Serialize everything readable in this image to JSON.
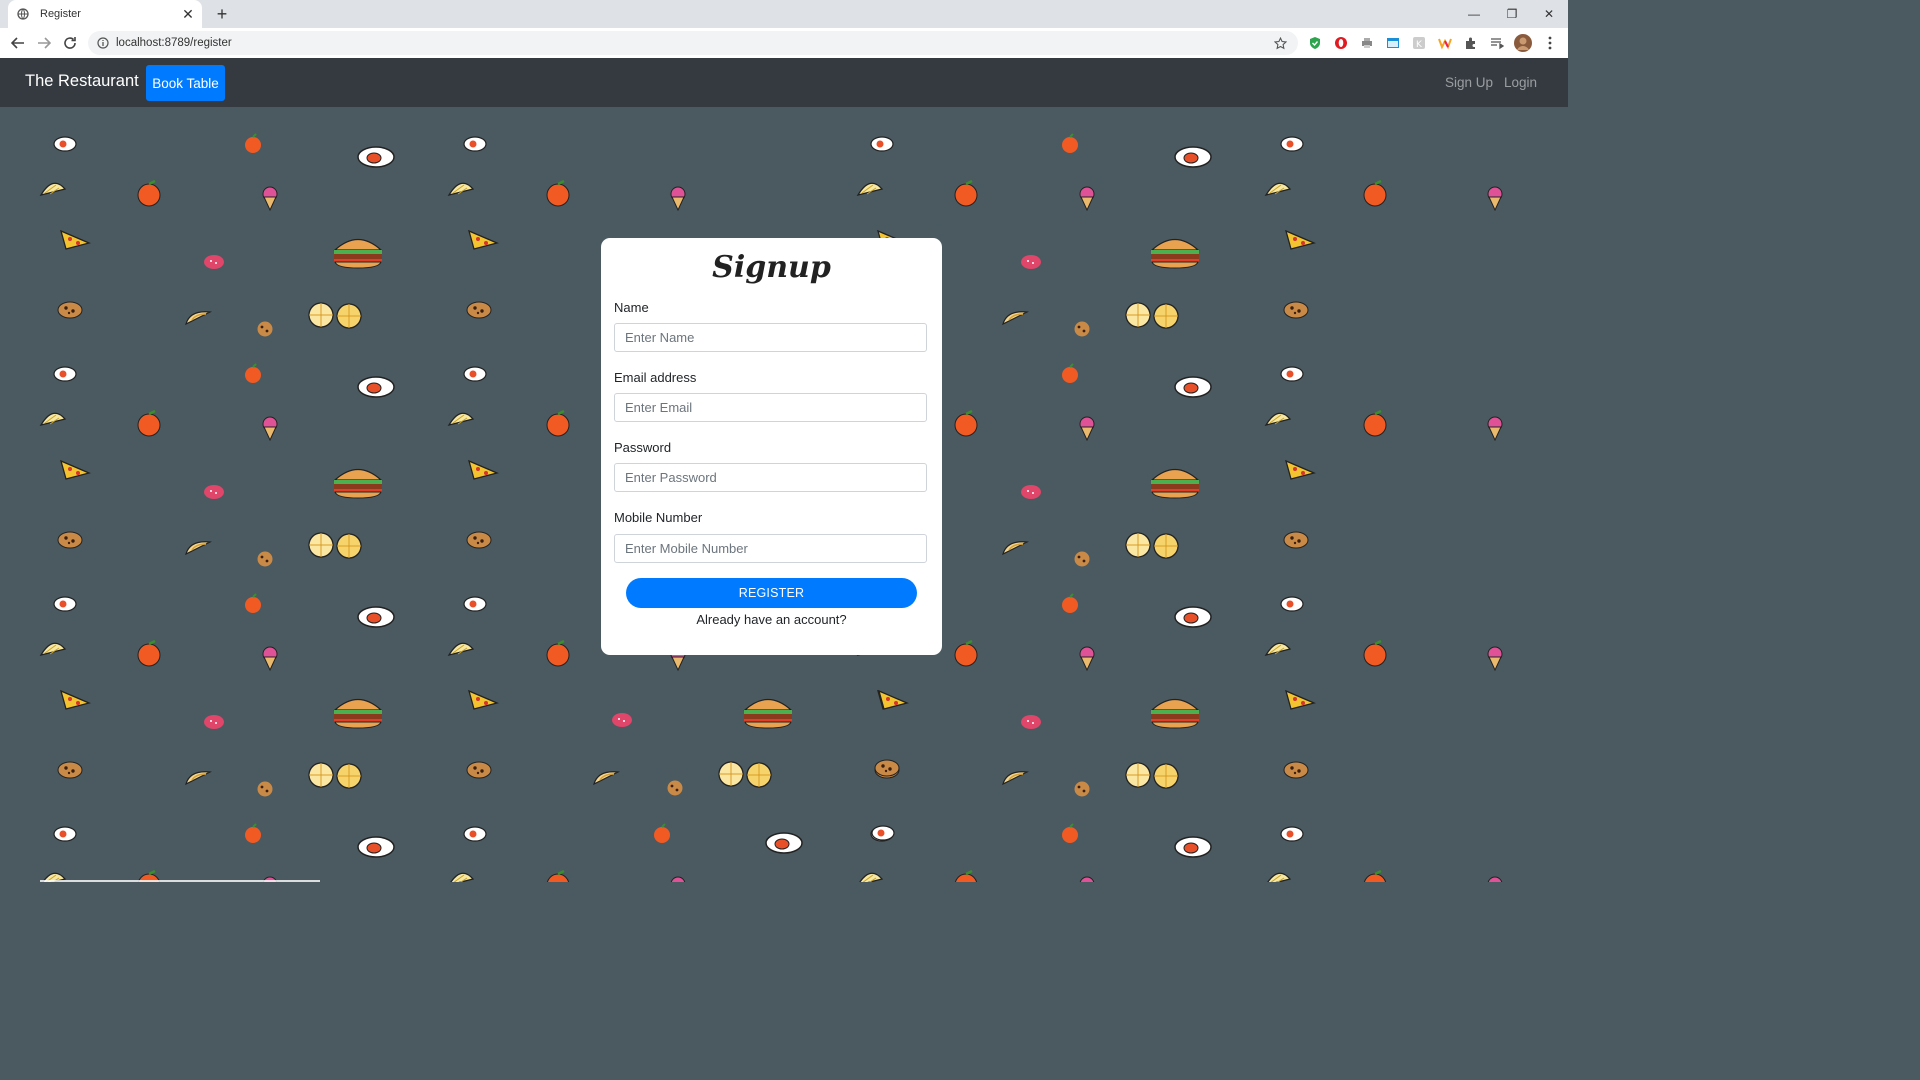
{
  "browser": {
    "tab_title": "Register",
    "url": "localhost:8789/register"
  },
  "navbar": {
    "brand": "The Restaurant",
    "book_table": "Book Table",
    "signup": "Sign Up",
    "login": "Login"
  },
  "form": {
    "title": "Signup",
    "name_label": "Name",
    "name_placeholder": "Enter Name",
    "email_label": "Email address",
    "email_placeholder": "Enter Email",
    "password_label": "Password",
    "password_placeholder": "Enter Password",
    "mobile_label": "Mobile Number",
    "mobile_placeholder": "Enter Mobile Number",
    "register_button": "REGISTER",
    "already_account": "Already have an account?"
  },
  "colors": {
    "navbar_bg": "#343a40",
    "primary": "#007bff",
    "page_bg": "#4a5a60"
  }
}
